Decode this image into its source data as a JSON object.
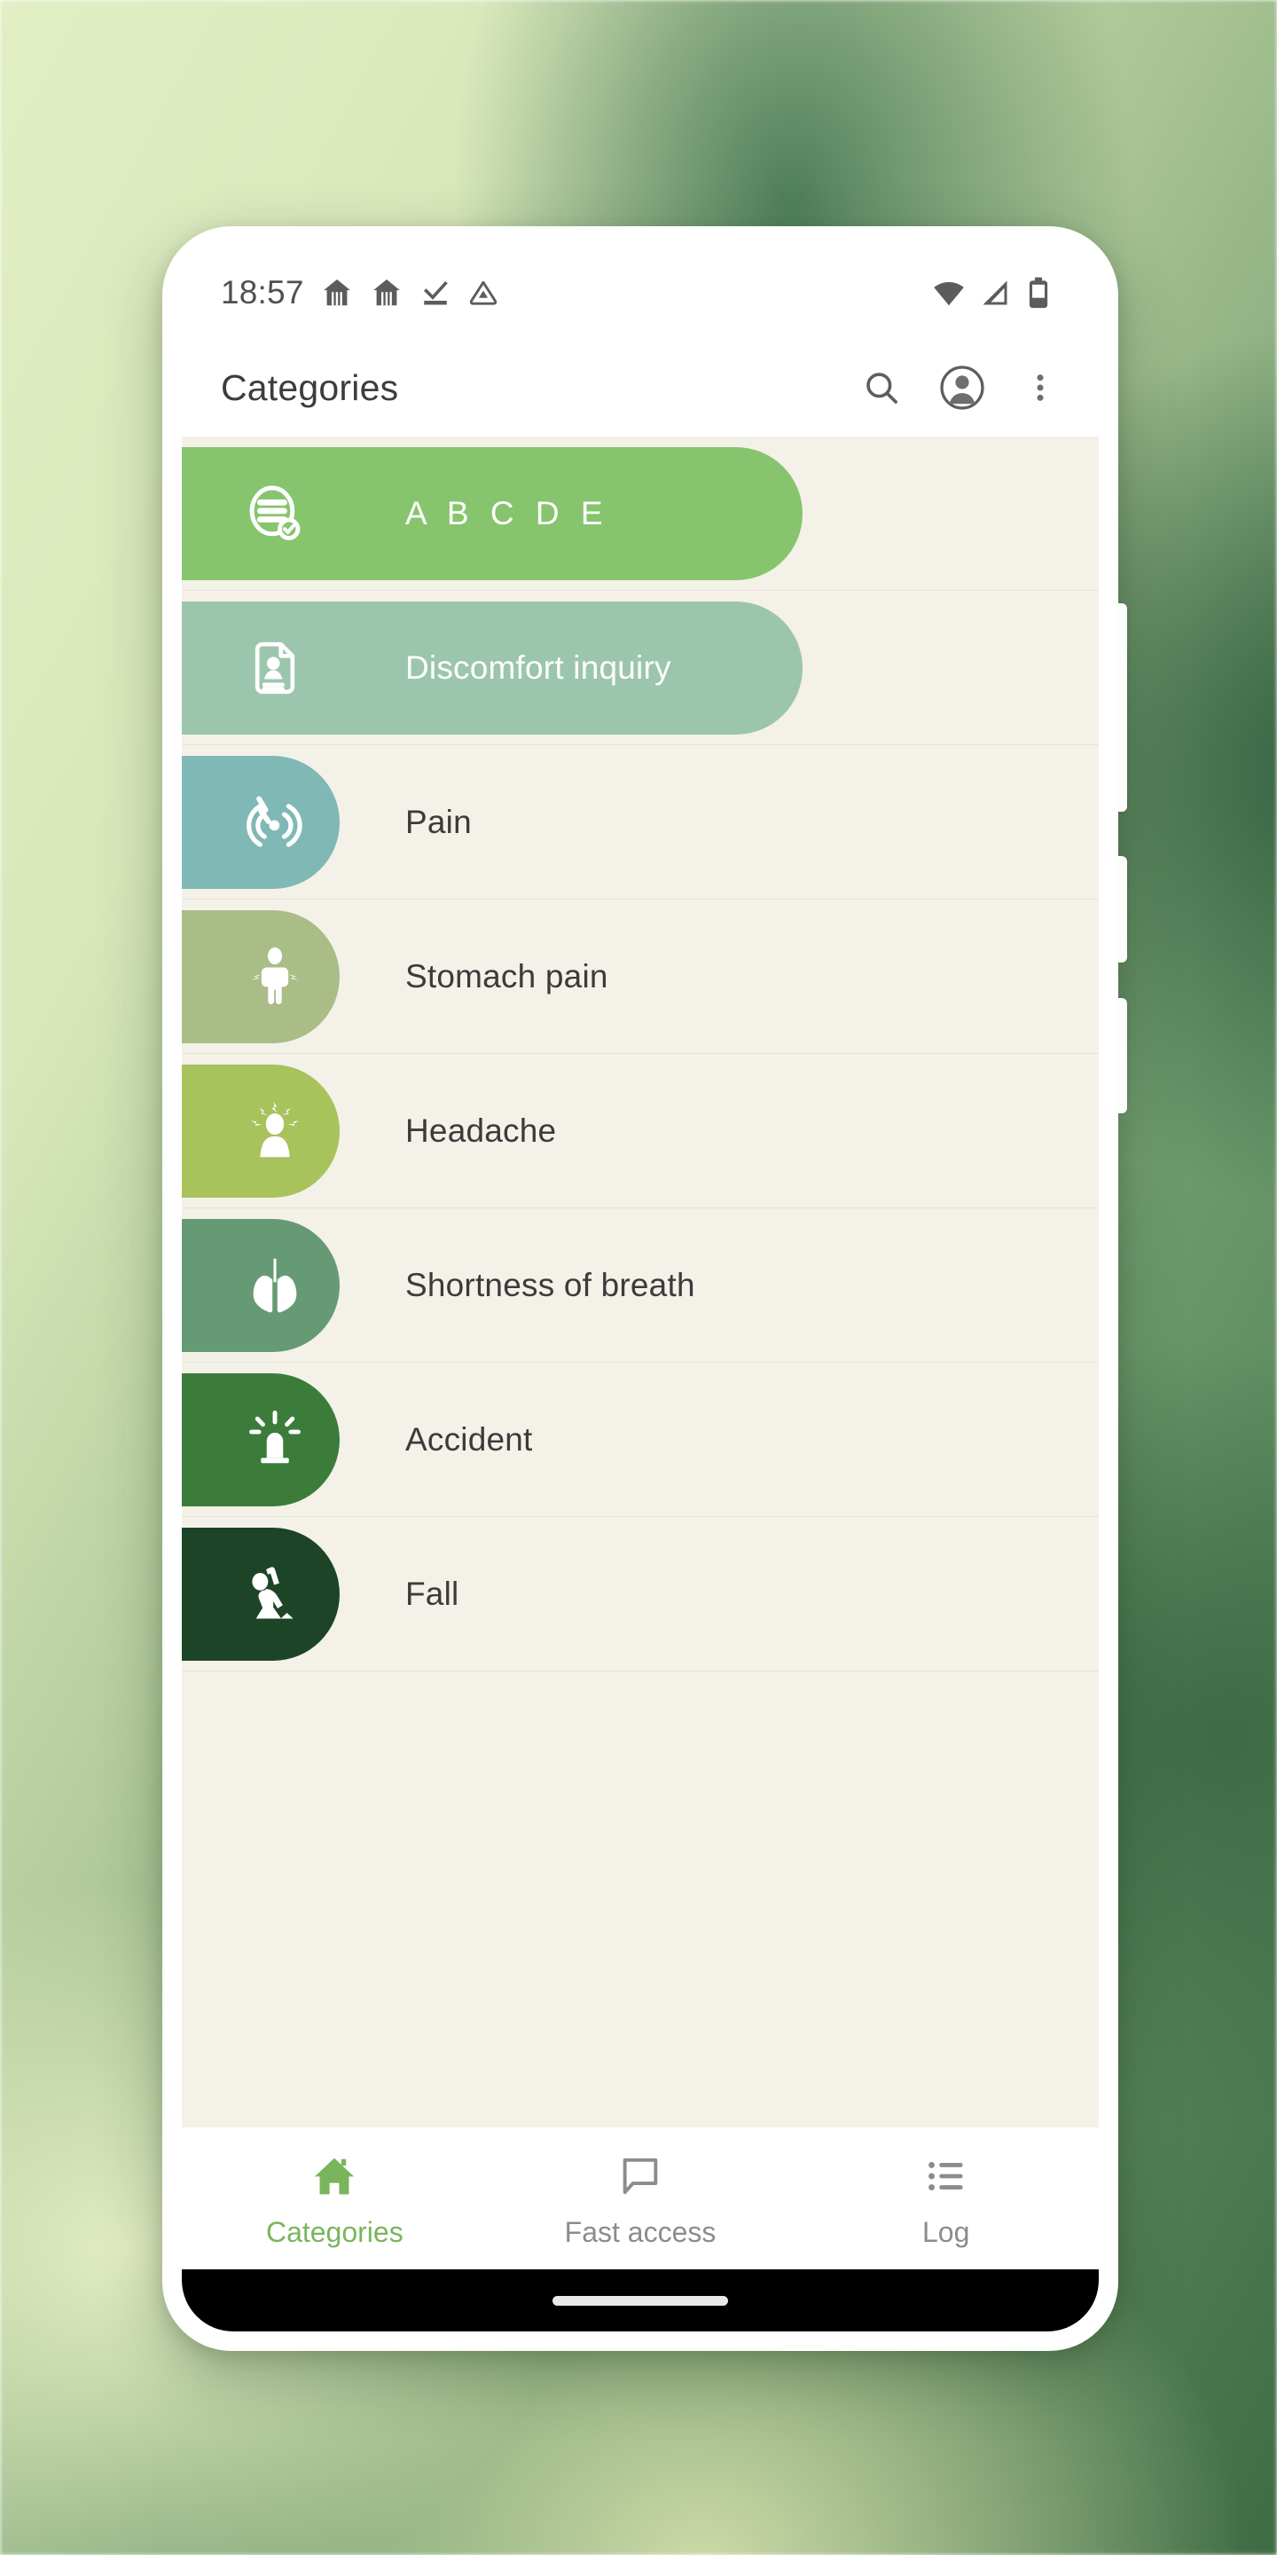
{
  "status_bar": {
    "time": "18:57",
    "notification_icons": [
      "home-alert-icon",
      "home-alert-icon",
      "task-done-icon",
      "cloud-warning-icon"
    ],
    "system_icons": [
      "wifi-icon",
      "cellular-signal-icon",
      "battery-icon"
    ]
  },
  "app_bar": {
    "title": "Categories",
    "actions": [
      "search-icon",
      "account-avatar-icon",
      "overflow-menu-icon"
    ]
  },
  "list": {
    "items": [
      {
        "label": "A B C D E",
        "icon": "checklist-circle-icon",
        "color": "#86c56e",
        "pill": "long",
        "label_on_pill": true,
        "spaced": true
      },
      {
        "label": "Discomfort inquiry",
        "icon": "patient-document-icon",
        "color": "#9cc5ae",
        "pill": "long",
        "label_on_pill": true,
        "spaced": false
      },
      {
        "label": "Pain",
        "icon": "pain-radiate-icon",
        "color": "#7fb8b4",
        "pill": "short",
        "label_on_pill": false,
        "spaced": false
      },
      {
        "label": "Stomach pain",
        "icon": "stomach-pain-icon",
        "color": "#aabd87",
        "pill": "short",
        "label_on_pill": false,
        "spaced": false
      },
      {
        "label": "Headache",
        "icon": "headache-icon",
        "color": "#a8c25c",
        "pill": "short",
        "label_on_pill": false,
        "spaced": false
      },
      {
        "label": "Shortness of breath",
        "icon": "lungs-icon",
        "color": "#669a74",
        "pill": "short",
        "label_on_pill": false,
        "spaced": false
      },
      {
        "label": "Accident",
        "icon": "emergency-beacon-icon",
        "color": "#3b7c3b",
        "pill": "short",
        "label_on_pill": false,
        "spaced": false
      },
      {
        "label": "Fall",
        "icon": "falling-person-icon",
        "color": "#1d4427",
        "pill": "short",
        "label_on_pill": false,
        "spaced": false
      }
    ]
  },
  "bottom_nav": {
    "items": [
      {
        "label": "Categories",
        "icon": "home-icon",
        "active": true
      },
      {
        "label": "Fast access",
        "icon": "speech-bubble-icon",
        "active": false
      },
      {
        "label": "Log",
        "icon": "list-icon",
        "active": false
      }
    ]
  },
  "colors": {
    "accent": "#7ab55c",
    "list_background": "#F4F1E9",
    "surface": "#FFFFFF",
    "text_primary": "#3b3b3b",
    "text_muted": "#8c8c8c"
  }
}
